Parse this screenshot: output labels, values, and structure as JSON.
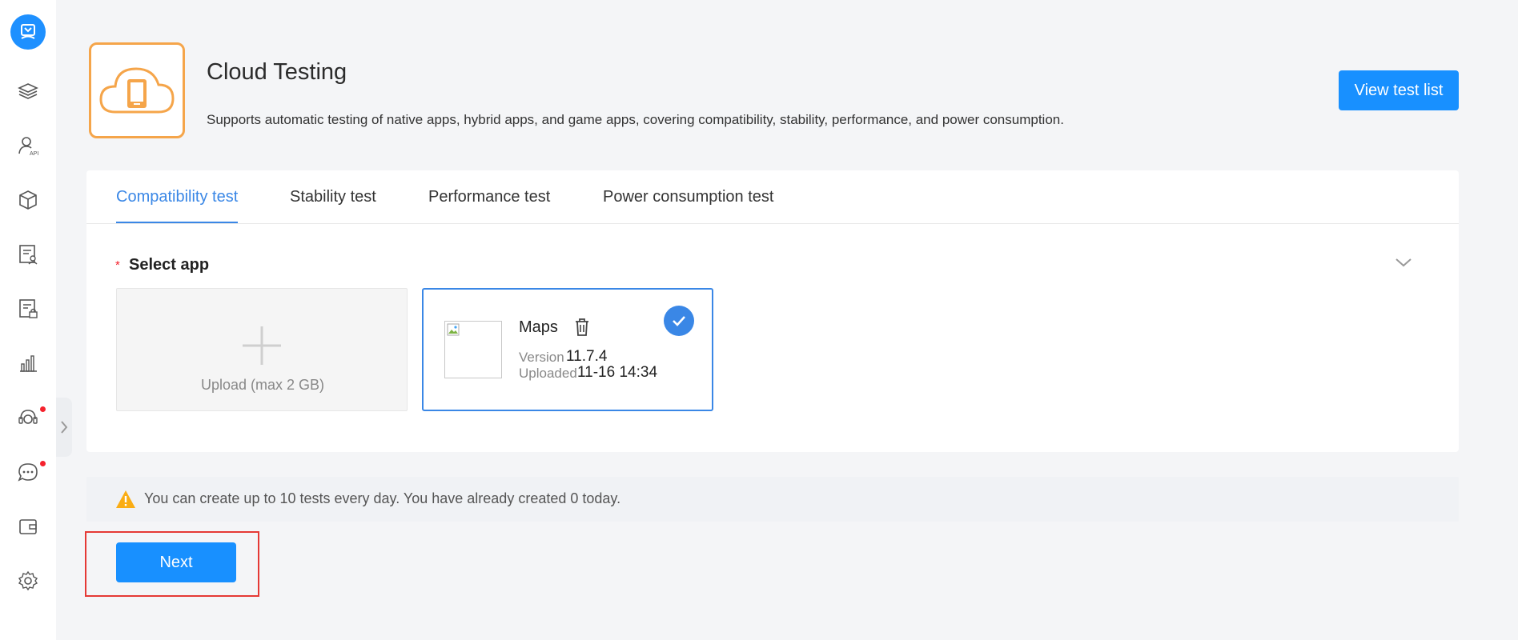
{
  "sidebar": {
    "items": [
      {
        "icon": "layers-icon"
      },
      {
        "icon": "user-api-icon",
        "badge": "API"
      },
      {
        "icon": "cube-icon"
      },
      {
        "icon": "document-user-icon"
      },
      {
        "icon": "document-lock-icon"
      },
      {
        "icon": "bar-chart-icon"
      },
      {
        "icon": "headset-icon",
        "dot": true
      },
      {
        "icon": "chat-icon",
        "dot": true
      },
      {
        "icon": "wallet-icon"
      },
      {
        "icon": "settings-icon"
      }
    ]
  },
  "header": {
    "title": "Cloud Testing",
    "description": "Supports automatic testing of native apps, hybrid apps, and game apps, covering compatibility, stability, performance, and power consumption.",
    "view_list_label": "View test list"
  },
  "tabs": [
    {
      "label": "Compatibility test",
      "active": true
    },
    {
      "label": "Stability test"
    },
    {
      "label": "Performance test"
    },
    {
      "label": "Power consumption test"
    }
  ],
  "select_app": {
    "required_mark": "*",
    "label": "Select app",
    "upload_label": "Upload (max 2 GB)",
    "app": {
      "name": "Maps",
      "version_label": "Version",
      "version": "11.7.4",
      "uploaded_label": "Uploaded",
      "uploaded": "11-16 14:34",
      "selected": true
    }
  },
  "notice": {
    "text": "You can create up to 10 tests every day. You have already created 0 today."
  },
  "next_label": "Next",
  "colors": {
    "primary": "#1890ff",
    "accent_tab": "#3a87e6",
    "header_icon": "#f5a54a",
    "warning": "#faad14",
    "highlight_outline": "#e53935"
  }
}
